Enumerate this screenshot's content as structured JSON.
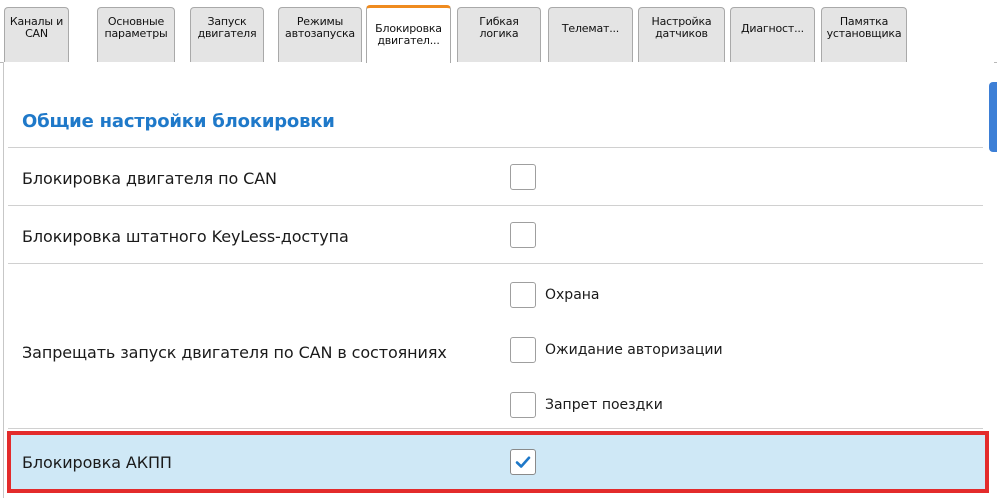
{
  "tabs": [
    {
      "label": "Каналы и\nCAN",
      "active": false
    },
    {
      "label": "Основные\nпараметры",
      "active": false
    },
    {
      "label": "Запуск\nдвигателя",
      "active": false
    },
    {
      "label": "Режимы\nавтозапуска",
      "active": false
    },
    {
      "label": "Блокировка\nдвигател...",
      "active": true
    },
    {
      "label": "Гибкая\nлогика",
      "active": false
    },
    {
      "label": "Телемат...",
      "active": false
    },
    {
      "label": "Настройка\nдатчиков",
      "active": false
    },
    {
      "label": "Диагност...",
      "active": false
    },
    {
      "label": "Памятка\nустановщика",
      "active": false
    }
  ],
  "section": {
    "title": "Общие настройки блокировки"
  },
  "rows": {
    "can_engine_block": {
      "label": "Блокировка двигателя по CAN",
      "checked": false
    },
    "keyless_block": {
      "label": "Блокировка штатного KeyLess-доступа",
      "checked": false
    },
    "deny_start": {
      "label": "Запрещать запуск двигателя по CAN в состояниях",
      "options": [
        {
          "label": "Охрана",
          "checked": false
        },
        {
          "label": "Ожидание авторизации",
          "checked": false
        },
        {
          "label": "Запрет поездки",
          "checked": false
        }
      ]
    },
    "akpp_block": {
      "label": "Блокировка АКПП",
      "checked": true
    }
  },
  "colors": {
    "accent_title": "#1f79c9",
    "active_tab_top": "#ef8b1f",
    "highlight_bg": "#cfe8f6",
    "highlight_border": "#e32b2b",
    "checkmark": "#1e78c8"
  }
}
